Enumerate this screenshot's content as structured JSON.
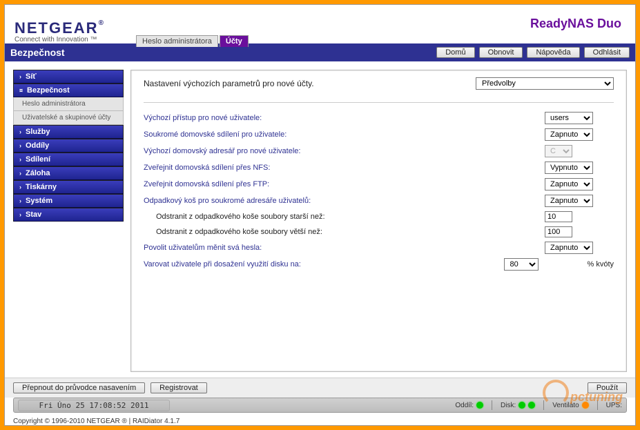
{
  "brand": {
    "name": "NETGEAR",
    "reg": "®",
    "tagline": "Connect with Innovation ™"
  },
  "product": "ReadyNAS Duo",
  "tabs": [
    {
      "label": "Heslo administrátora",
      "active": false
    },
    {
      "label": "Účty",
      "active": true
    }
  ],
  "page_title": "Bezpečnost",
  "top_buttons": {
    "home": "Domů",
    "refresh": "Obnovit",
    "help": "Nápověda",
    "logout": "Odhlásit"
  },
  "sidebar": {
    "items": [
      {
        "label": "Síť",
        "expanded": false
      },
      {
        "label": "Bezpečnost",
        "expanded": true,
        "children": [
          {
            "label": "Heslo administrátora"
          },
          {
            "label": "Uživatelské a skupinové účty"
          }
        ]
      },
      {
        "label": "Služby"
      },
      {
        "label": "Oddíly"
      },
      {
        "label": "Sdílení"
      },
      {
        "label": "Záloha"
      },
      {
        "label": "Tiskárny"
      },
      {
        "label": "Systém"
      },
      {
        "label": "Stav"
      }
    ]
  },
  "main": {
    "heading": "Nastavení výchozích parametrů pro nové účty.",
    "view_select": "Předvolby",
    "rows": {
      "default_group": {
        "label": "Výchozí přístup pro nové uživatele:",
        "value": "users"
      },
      "private_home": {
        "label": "Soukromé domovské sdílení pro uživatele:",
        "value": "Zapnuto"
      },
      "default_home_dir": {
        "label": "Výchozí domovský adresář pro nové uživatele:",
        "value": "C",
        "disabled": true
      },
      "nfs": {
        "label": "Zveřejnit domovská sdílení přes NFS:",
        "value": "Vypnuto"
      },
      "ftp": {
        "label": "Zveřejnit domovská sdílení přes FTP:",
        "value": "Zapnuto"
      },
      "recycle": {
        "label": "Odpadkový koš pro soukromé adresáře uživatelů:",
        "value": "Zapnuto"
      },
      "recycle_age": {
        "label": "Odstranit z odpadkového koše soubory starší než:",
        "value": "10"
      },
      "recycle_size": {
        "label": "Odstranit z odpadkového koše soubory větší než:",
        "value": "100"
      },
      "allow_pw": {
        "label": "Povolit uživatelům měnit svá hesla:",
        "value": "Zapnuto"
      },
      "warn_quota": {
        "label": "Varovat uživatele při dosažení využití disku na:",
        "value": "80",
        "suffix": "% kvóty"
      }
    }
  },
  "footer_buttons": {
    "wizard": "Přepnout do průvodce nasavením",
    "register": "Registrovat",
    "apply": "Použít"
  },
  "status": {
    "time": "Fri Úno 25  17:08:52 2011",
    "volume": "Oddíl:",
    "disk": "Disk:",
    "fan": "Ventiláto",
    "ups": "UPS:"
  },
  "copyright": "Copyright © 1996-2010 NETGEAR ® | RAIDiator 4.1.7",
  "watermark": "pctuning"
}
